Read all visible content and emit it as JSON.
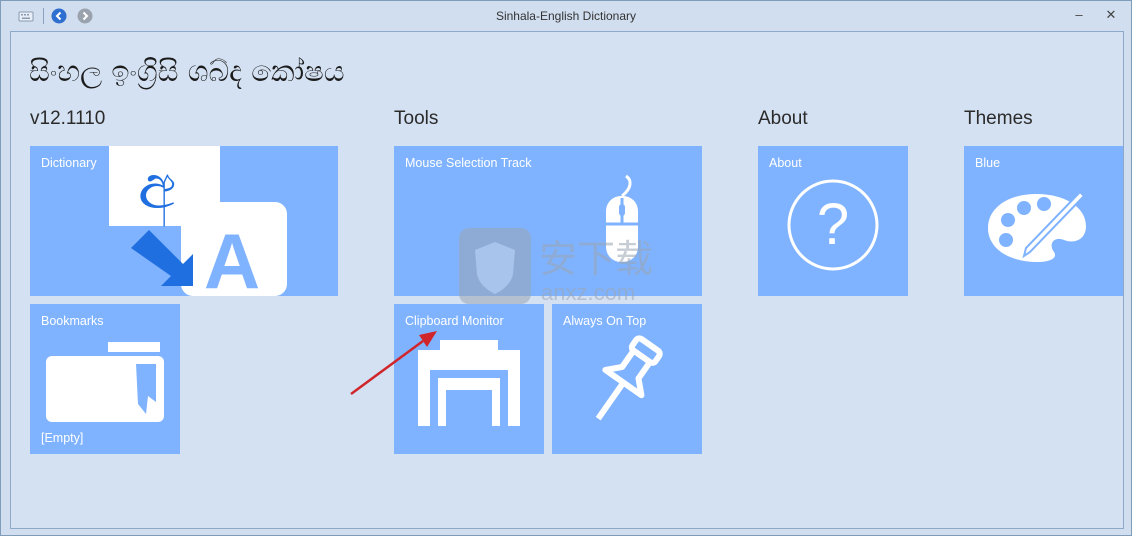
{
  "window": {
    "title": "Sinhala-English Dictionary"
  },
  "titlebar_icons": {
    "app": "keyboard-icon",
    "back": "back-arrow-icon",
    "forward": "forward-arrow-icon"
  },
  "window_controls": {
    "minimize": "–",
    "close": "✕"
  },
  "app_title": "සිංහල ඉංග්‍රිසි ශබ්ද කෝෂය",
  "groups": [
    {
      "heading": "v12.1110"
    },
    {
      "heading": "Tools"
    },
    {
      "heading": "About"
    },
    {
      "heading": "Themes"
    }
  ],
  "tiles": {
    "dictionary": {
      "label": "Dictionary",
      "glyph_si": "අ",
      "glyph_en": "A"
    },
    "bookmarks": {
      "label": "Bookmarks",
      "status": "[Empty]"
    },
    "mouse_selection": {
      "label": "Mouse Selection Track"
    },
    "clipboard_monitor": {
      "label": "Clipboard Monitor"
    },
    "always_on_top": {
      "label": "Always On Top"
    },
    "about": {
      "label": "About",
      "glyph": "?"
    },
    "theme_blue": {
      "label": "Blue"
    }
  },
  "watermark": {
    "text_cn": "安下载",
    "text_en": "anxz.com"
  },
  "colors": {
    "tile": "#80b3ff",
    "background": "#d4e1f2",
    "titlebar": "#d1deef",
    "annotation_arrow": "#d0262b"
  }
}
